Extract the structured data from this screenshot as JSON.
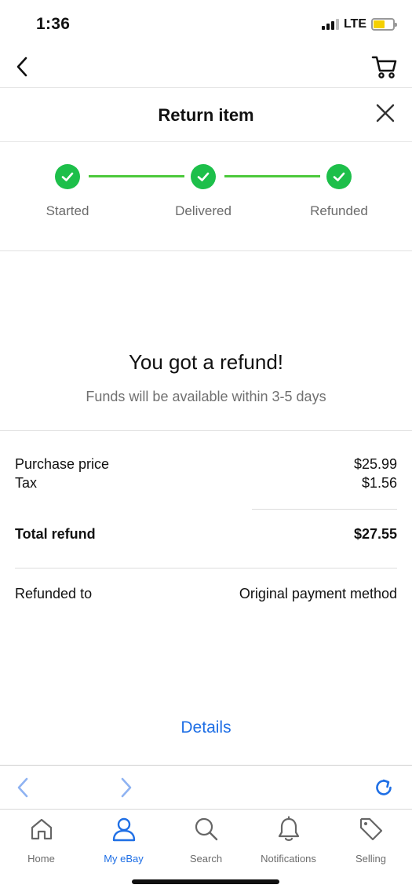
{
  "status_bar": {
    "time": "1:36",
    "network": "LTE"
  },
  "header": {
    "title": "Return item"
  },
  "progress": {
    "steps": [
      {
        "label": "Started",
        "done": true
      },
      {
        "label": "Delivered",
        "done": true
      },
      {
        "label": "Refunded",
        "done": true
      }
    ],
    "color": "#1dbf4a"
  },
  "hero": {
    "title": "You got a refund!",
    "subtitle": "Funds will be available within 3-5 days"
  },
  "breakdown": {
    "purchase_price_label": "Purchase price",
    "purchase_price_value": "$25.99",
    "tax_label": "Tax",
    "tax_value": "$1.56",
    "total_label": "Total refund",
    "total_value": "$27.55",
    "refunded_to_label": "Refunded to",
    "refunded_to_value": "Original payment method"
  },
  "details_link": "Details",
  "tabs": [
    {
      "label": "Home",
      "icon": "home-icon",
      "active": false
    },
    {
      "label": "My eBay",
      "icon": "user-icon",
      "active": true
    },
    {
      "label": "Search",
      "icon": "search-icon",
      "active": false
    },
    {
      "label": "Notifications",
      "icon": "bell-icon",
      "active": false
    },
    {
      "label": "Selling",
      "icon": "tag-icon",
      "active": false
    }
  ],
  "colors": {
    "accent": "#1f6fe5",
    "success": "#1dbf4a"
  }
}
